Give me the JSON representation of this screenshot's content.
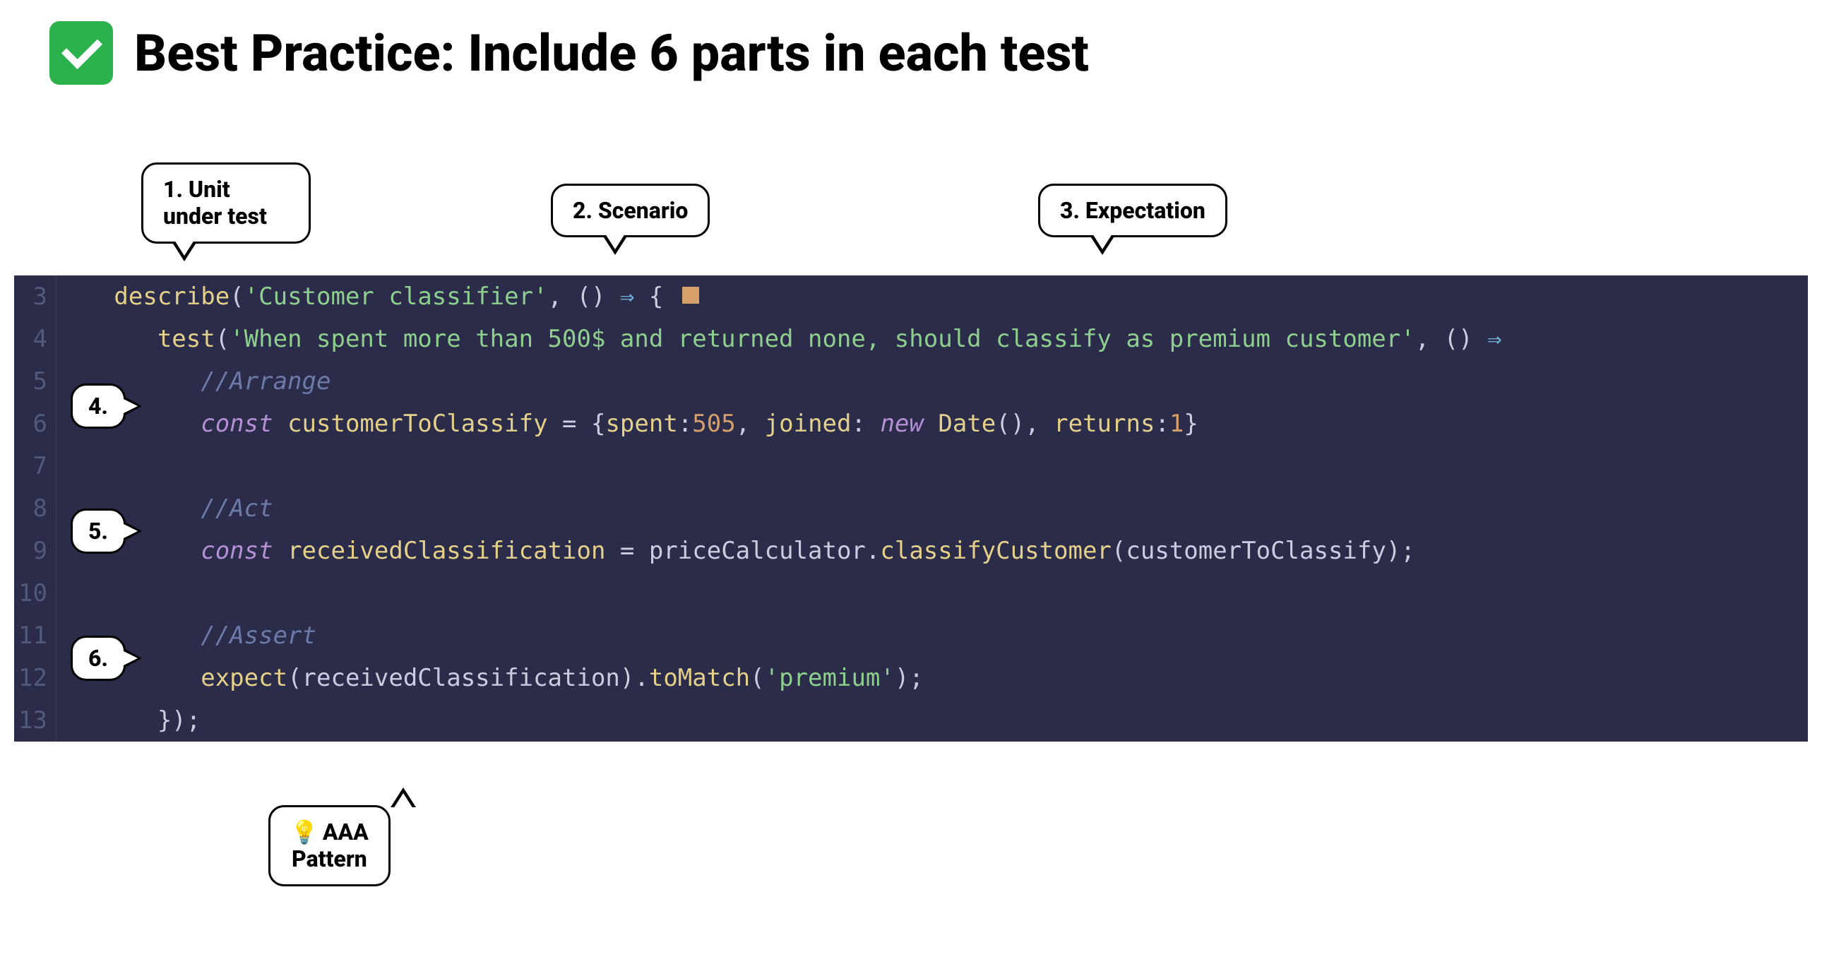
{
  "heading": {
    "text": "Best Practice: Include 6 parts in each test"
  },
  "callouts": {
    "unit_under_test": "1. Unit under test",
    "scenario": "2. Scenario",
    "expectation": "3.  Expectation",
    "four": "4.",
    "five": "5.",
    "six": "6.",
    "aaa_line1": "AAA",
    "aaa_line2": "Pattern"
  },
  "code": {
    "line3": {
      "describe": "describe",
      "str": "'Customer classifier'",
      "arrow": " ⇒ "
    },
    "line4": {
      "test": "test",
      "str": "'When spent more than 500$ and returned none, should classify as premium customer'",
      "arrow": " ⇒"
    },
    "line5": {
      "comment": "//Arrange"
    },
    "line6": {
      "const": "const",
      "var": "customerToClassify",
      "eq": " = ",
      "spent": "spent",
      "spent_val": "505",
      "joined": "joined",
      "new": "new",
      "date": "Date",
      "returns": "returns",
      "returns_val": "1"
    },
    "line8": {
      "comment": "//Act"
    },
    "line9": {
      "const": "const",
      "var": "receivedClassification",
      "eq": " = ",
      "obj": "priceCalculator",
      "method": "classifyCustomer",
      "arg": "customerToClassify"
    },
    "line11": {
      "comment": "//Assert"
    },
    "line12": {
      "expect": "expect",
      "arg": "receivedClassification",
      "toMatch": "toMatch",
      "str": "'premium'"
    }
  },
  "line_numbers": [
    "3",
    "4",
    "5",
    "6",
    "7",
    "8",
    "9",
    "10",
    "11",
    "12",
    "13"
  ]
}
